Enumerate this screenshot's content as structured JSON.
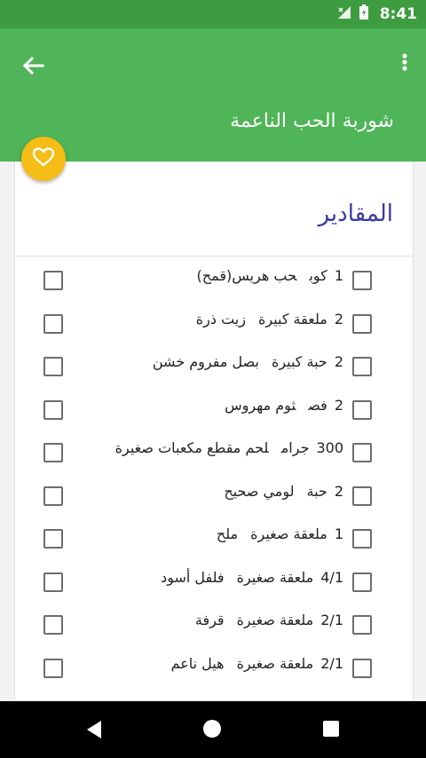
{
  "status_bar": {
    "time": "8:41"
  },
  "appbar": {
    "title": "شوربة الحب الناعمة"
  },
  "section": {
    "title": "المقادير"
  },
  "ingredients": [
    {
      "qty": "1",
      "unit": "كوب",
      "name": "حب هريس(قمح)"
    },
    {
      "qty": "2",
      "unit": "ملعقة كبيرة",
      "name": "زيت ذرة"
    },
    {
      "qty": "2",
      "unit": "حبة كبيرة",
      "name": "بصل مفروم خشن"
    },
    {
      "qty": "2",
      "unit": "فص",
      "name": "ثوم مهروس"
    },
    {
      "qty": "300",
      "unit": "جرام",
      "name": "لحم مقطع مكعبات صغيرة"
    },
    {
      "qty": "2",
      "unit": "حبة",
      "name": "لومي صحيح"
    },
    {
      "qty": "1",
      "unit": "ملعقة صغيرة",
      "name": "ملح"
    },
    {
      "qty": "4/1",
      "unit": "ملعقة صغيرة",
      "name": "فلفل أسود"
    },
    {
      "qty": "2/1",
      "unit": "ملعقة صغيرة",
      "name": "قرفة"
    },
    {
      "qty": "2/1",
      "unit": "ملعقة صغيرة",
      "name": "هيل ناعم"
    }
  ],
  "colors": {
    "primary": "#4fb558",
    "status": "#3d9c3f",
    "accent": "#f5bd15",
    "section_title": "#3b3aa0"
  }
}
